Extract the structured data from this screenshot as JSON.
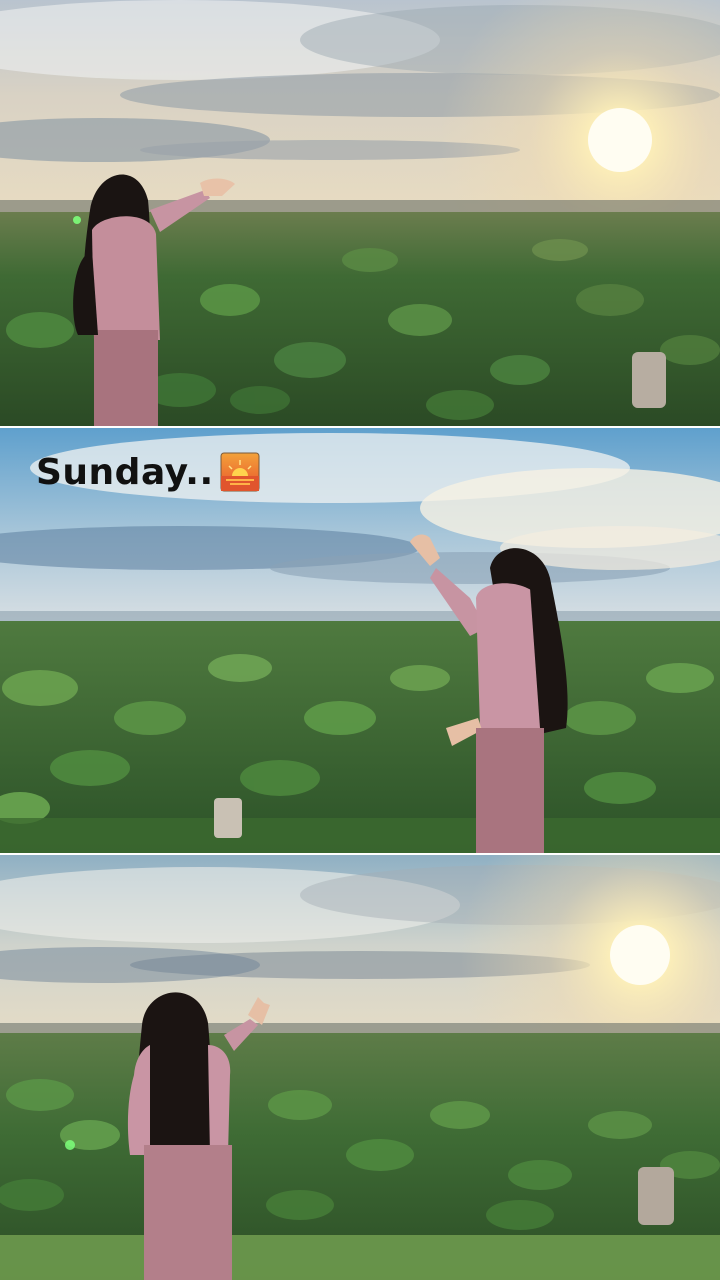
{
  "caption": {
    "text": "Sunday..",
    "emoji": "sunset-emoji"
  },
  "panels": [
    {
      "name": "photo-top",
      "scene": "sunset-over-lotus-field"
    },
    {
      "name": "photo-middle",
      "scene": "cloudy-sky-over-lotus-field"
    },
    {
      "name": "photo-bottom",
      "scene": "sunset-over-lotus-field"
    }
  ],
  "colors": {
    "leaf_dark": "#2f5a2a",
    "leaf_light": "#5e9148",
    "outfit_pink": "#b98592",
    "sun": "#fff6c8",
    "sky_blue": "#6fa9cf"
  }
}
